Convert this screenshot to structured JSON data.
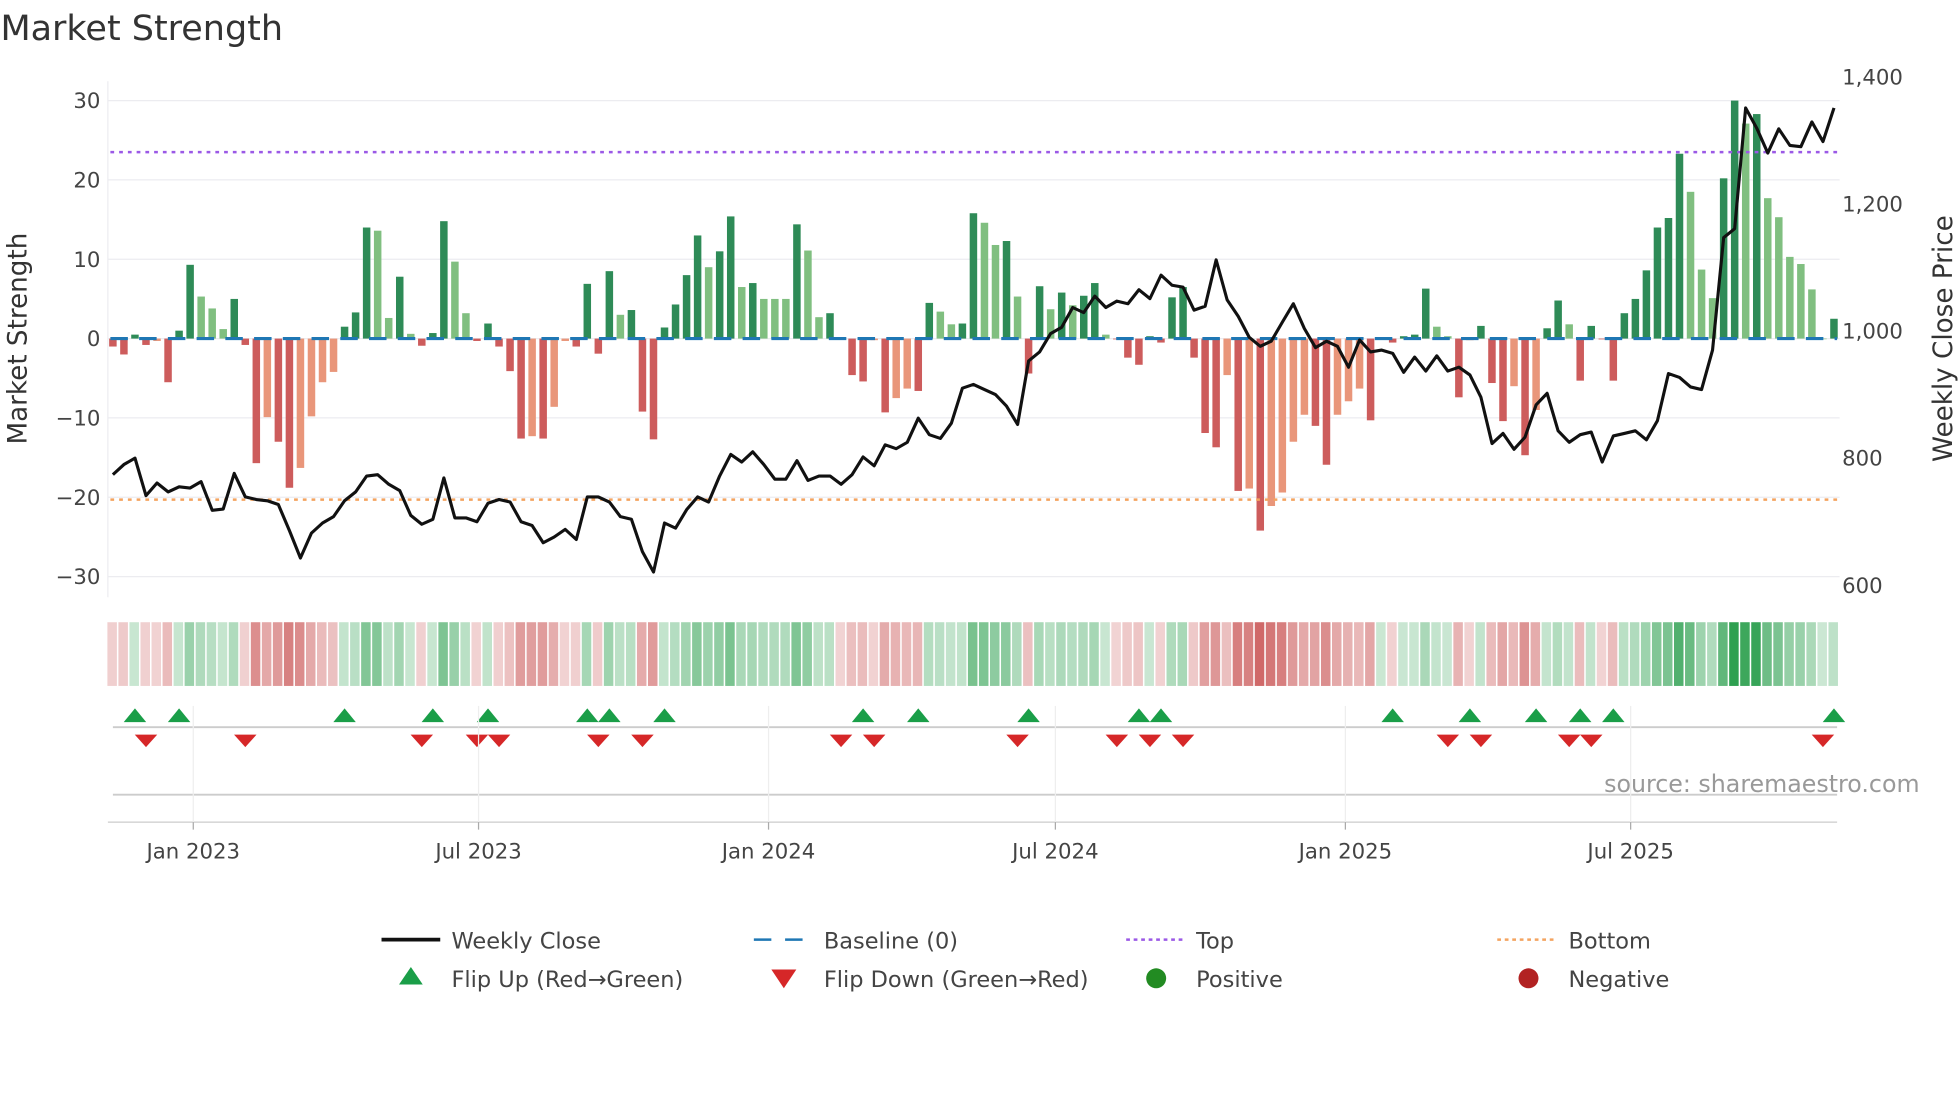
{
  "title": "Market Strength",
  "source": "source: sharemaestro.com",
  "chart_data": {
    "type": "bar",
    "title": "Market Strength",
    "ylabel": "Market Strength",
    "y2label": "Weekly Close Price",
    "ylim": [
      -32,
      32
    ],
    "y2lim": [
      600,
      1400
    ],
    "yticks": [
      30,
      20,
      10,
      0,
      -10,
      -20,
      -30
    ],
    "ytick_labels": [
      "30",
      "20",
      "10",
      "0",
      "−10",
      "−20",
      "−30"
    ],
    "y2ticks": [
      1400,
      1200,
      1000,
      800,
      600
    ],
    "y2tick_labels": [
      "1,400",
      "1,200",
      "1,000",
      "800",
      "600"
    ],
    "x_start": "2022-11-11",
    "x_step_days": 7,
    "xticks": [
      {
        "date": "2023-01-01",
        "label": "Jan 2023"
      },
      {
        "date": "2023-07-01",
        "label": "Jul 2023"
      },
      {
        "date": "2024-01-01",
        "label": "Jan 2024"
      },
      {
        "date": "2024-07-01",
        "label": "Jul 2024"
      },
      {
        "date": "2025-01-01",
        "label": "Jan 2025"
      },
      {
        "date": "2025-07-01",
        "label": "Jul 2025"
      }
    ],
    "top": 23.5,
    "bottom": -20.3,
    "baseline": 0,
    "strength": [
      -1,
      -2,
      0.5,
      -0.8,
      -0.3,
      -5.5,
      1,
      9.3,
      5.3,
      3.8,
      1.2,
      5,
      -0.8,
      -15.7,
      -9.9,
      -13,
      -18.8,
      -16.3,
      -9.8,
      -5.5,
      -4.2,
      1.5,
      3.3,
      14,
      13.6,
      2.6,
      7.8,
      0.6,
      -0.9,
      0.7,
      14.8,
      9.7,
      3.2,
      -0.3,
      1.9,
      -1,
      -4.1,
      -12.6,
      -12.3,
      -12.6,
      -8.6,
      -0.3,
      -1,
      6.9,
      -1.9,
      8.5,
      3,
      3.6,
      -9.2,
      -12.7,
      1.4,
      4.3,
      8,
      13,
      9,
      11,
      15.4,
      6.5,
      7,
      5,
      5,
      5,
      14.4,
      11.1,
      2.7,
      3.2,
      -0.1,
      -4.6,
      -5.4,
      -0.2,
      -9.3,
      -7.5,
      -6.3,
      -6.6,
      4.5,
      3.4,
      1.8,
      1.9,
      15.8,
      14.6,
      11.8,
      12.3,
      5.3,
      -4.4,
      6.6,
      3.7,
      5.8,
      4.2,
      5.4,
      7,
      0.5,
      -0.1,
      -2.4,
      -3.3,
      0.3,
      -0.5,
      5.2,
      6.5,
      -2.4,
      -11.9,
      -13.7,
      -4.6,
      -19.2,
      -18.9,
      -24.2,
      -21.1,
      -19.4,
      -13,
      -9.6,
      -11,
      -15.9,
      -9.6,
      -7.9,
      -6.3,
      -10.3,
      0.2,
      -0.5,
      0.3,
      0.5,
      6.3,
      1.5,
      0.3,
      -7.4,
      -0.2,
      1.6,
      -5.6,
      -10.4,
      -6,
      -14.7,
      -9,
      1.3,
      4.8,
      1.8,
      -5.3,
      1.6,
      -0.1,
      -5.3,
      3.2,
      5,
      8.6,
      14,
      15.2,
      23.3,
      18.5,
      8.7,
      5.1,
      20.2,
      30,
      27.1,
      28.3,
      17.7,
      15.3,
      10.3,
      9.4,
      6.2,
      0,
      2.5
    ],
    "close": [
      780,
      796,
      806,
      747,
      767,
      753,
      761,
      759,
      769,
      724,
      726,
      782,
      745,
      741,
      739,
      733,
      692,
      649,
      688,
      704,
      714,
      739,
      753,
      778,
      780,
      765,
      755,
      716,
      702,
      710,
      775,
      712,
      712,
      706,
      735,
      741,
      737,
      706,
      700,
      673,
      682,
      694,
      678,
      745,
      745,
      737,
      714,
      710,
      659,
      627,
      704,
      696,
      725,
      745,
      737,
      778,
      812,
      800,
      816,
      796,
      773,
      773,
      802,
      771,
      778,
      778,
      765,
      780,
      808,
      794,
      827,
      821,
      831,
      869,
      843,
      837,
      861,
      916,
      922,
      914,
      906,
      888,
      859,
      959,
      973,
      1002,
      1012,
      1043,
      1035,
      1061,
      1043,
      1053,
      1049,
      1071,
      1057,
      1094,
      1078,
      1075,
      1039,
      1045,
      1118,
      1055,
      1029,
      996,
      982,
      990,
      1020,
      1049,
      1010,
      980,
      990,
      982,
      949,
      992,
      973,
      976,
      971,
      941,
      965,
      943,
      967,
      943,
      949,
      937,
      902,
      829,
      845,
      820,
      839,
      890,
      908,
      849,
      831,
      843,
      847,
      800,
      841,
      845,
      849,
      835,
      865,
      939,
      933,
      918,
      914,
      976,
      1153,
      1167,
      1357,
      1325,
      1286,
      1324,
      1298,
      1296,
      1335,
      1304,
      1357
    ],
    "flip_up_weeks": [
      2,
      6,
      21,
      29,
      34,
      43,
      45,
      50,
      68,
      73,
      83,
      93,
      95,
      116,
      123,
      129,
      133,
      136,
      156
    ],
    "flip_down_weeks": [
      3,
      12,
      28,
      33,
      35,
      44,
      48,
      66,
      69,
      82,
      91,
      94,
      97,
      121,
      124,
      132,
      134,
      155
    ],
    "legend": [
      {
        "label": "Weekly Close",
        "kind": "line"
      },
      {
        "label": "Baseline (0)",
        "kind": "dash"
      },
      {
        "label": "Top",
        "kind": "dot-purple"
      },
      {
        "label": "Bottom",
        "kind": "dot-orange"
      },
      {
        "label": "Flip Up (Red→Green)",
        "kind": "tri-up"
      },
      {
        "label": "Flip Down (Green→Red)",
        "kind": "tri-down"
      },
      {
        "label": "Positive",
        "kind": "circle-green"
      },
      {
        "label": "Negative",
        "kind": "circle-red"
      }
    ],
    "legend_position": "bottom"
  },
  "colors": {
    "pos_strong": "#2e8b57",
    "pos_weak": "#80bf80",
    "neg_strong": "#cd5c5c",
    "neg_weak": "#e9967a",
    "baseline": "#1f77b4",
    "top": "#9b59e6",
    "bottom": "#f4a460",
    "flip_up": "#1a9e48",
    "flip_down": "#d62728",
    "positive": "#228b22",
    "negative": "#b22222"
  }
}
